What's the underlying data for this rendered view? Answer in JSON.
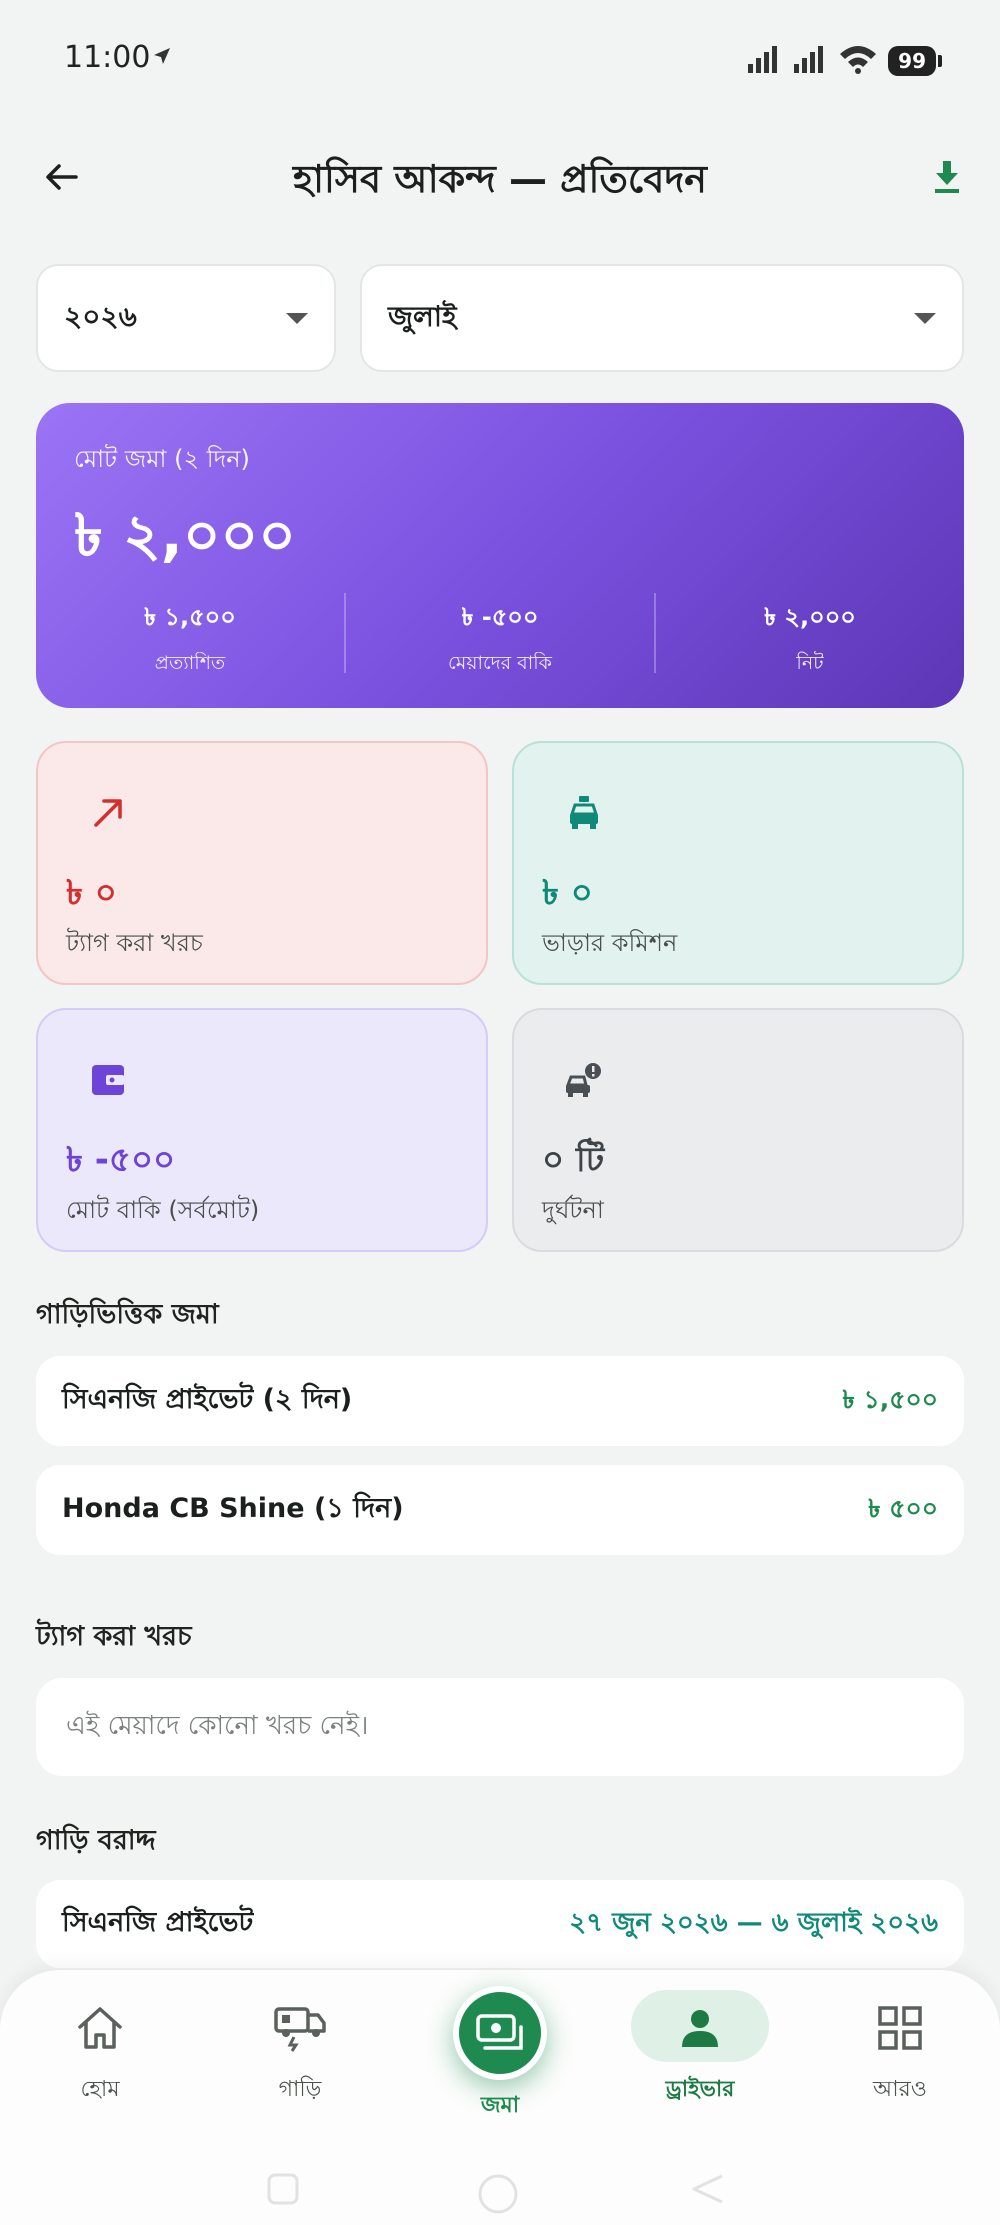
{
  "status_bar": {
    "time": "11:00",
    "battery": "99"
  },
  "header": {
    "title": "হাসিব আকন্দ — প্রতিবেদন"
  },
  "filters": {
    "year": "২০২৬",
    "month": "জুলাই"
  },
  "summary": {
    "label": "মোট জমা (২ দিন)",
    "total": "৳ ২,০০০",
    "stats": [
      {
        "value": "৳ ১,৫০০",
        "label": "প্রত্যাশিত"
      },
      {
        "value": "৳ -৫০০",
        "label": "মেয়াদের বাকি"
      },
      {
        "value": "৳ ২,০০০",
        "label": "নিট"
      }
    ]
  },
  "tiles": {
    "expense": {
      "value": "৳ ০",
      "label": "ট্যাগ করা খরচ"
    },
    "commission": {
      "value": "৳ ০",
      "label": "ভাড়ার কমিশন"
    },
    "due": {
      "value": "৳ -৫০০",
      "label": "মোট বাকি (সর্বমোট)"
    },
    "accident": {
      "value": "০ টি",
      "label": "দুর্ঘটনা"
    }
  },
  "vehicle_deposits": {
    "title": "গাড়িভিত্তিক জমা",
    "items": [
      {
        "name": "সিএনজি প্রাইভেট (২ দিন)",
        "amount": "৳ ১,৫০০"
      },
      {
        "name": "Honda CB Shine (১ দিন)",
        "amount": "৳ ৫০০"
      }
    ]
  },
  "tagged_expenses": {
    "title": "ট্যাগ করা খরচ",
    "empty": "এই মেয়াদে কোনো খরচ নেই।"
  },
  "vehicle_allocation": {
    "title": "গাড়ি বরাদ্দ",
    "items": [
      {
        "name": "সিএনজি প্রাইভেট",
        "period": "২৭ জুন ২০২৬ — ৬ জুলাই ২০২৬"
      }
    ]
  },
  "bottom_nav": {
    "items": [
      {
        "label": "হোম",
        "icon": "home-icon"
      },
      {
        "label": "গাড়ি",
        "icon": "vehicle-icon"
      },
      {
        "label": "জমা",
        "icon": "deposit-icon"
      },
      {
        "label": "ড্রাইভার",
        "icon": "person-icon"
      },
      {
        "label": "আরও",
        "icon": "grid-icon"
      }
    ]
  },
  "colors": {
    "primary": "#1e8a4f",
    "hero_start": "#9b74f5",
    "hero_end": "#5d36b6",
    "expense": "#d32f2f",
    "commission": "#0f8a78",
    "due": "#6d44d8"
  }
}
